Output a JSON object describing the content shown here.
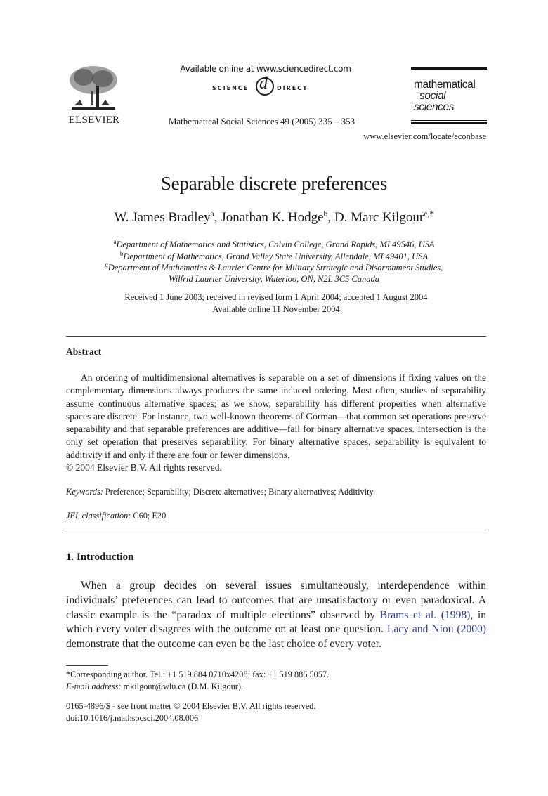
{
  "header": {
    "publisher_name": "ELSEVIER",
    "sciencedirect_available": "Available online at www.sciencedirect.com",
    "sciencedirect_logo_left": "SCIENCE",
    "sciencedirect_logo_at": "d",
    "sciencedirect_logo_right": "DIRECT",
    "journal_reference": "Mathematical Social Sciences 49 (2005) 335 – 353",
    "journal_logo": {
      "line1": "mathematical",
      "line2": "social",
      "line3": "sciences"
    },
    "journal_url": "www.elsevier.com/locate/econbase",
    "icons": {
      "publisher_logo": "elsevier-tree-logo",
      "sd_logo": "sciencedirect-logo"
    }
  },
  "article": {
    "title": "Separable discrete preferences",
    "authors": [
      {
        "name": "W. James Bradley",
        "affil": "a",
        "sep": ", "
      },
      {
        "name": "Jonathan K. Hodge",
        "affil": "b",
        "sep": ", "
      },
      {
        "name": "D. Marc Kilgour",
        "affil": "c,*",
        "sep": ""
      }
    ],
    "affiliations": [
      {
        "mark": "a",
        "text": "Department of Mathematics and Statistics, Calvin College, Grand Rapids, MI 49546, USA"
      },
      {
        "mark": "b",
        "text": "Department of Mathematics, Grand Valley State University, Allendale, MI 49401, USA"
      },
      {
        "mark": "c",
        "text": "Department of Mathematics & Laurier Centre for Military Strategic and Disarmament Studies,"
      },
      {
        "mark": "",
        "text": "Wilfrid Laurier University, Waterloo, ON, N2L 3C5 Canada"
      }
    ],
    "dates": {
      "received": "Received 1 June 2003; received in revised form 1 April 2004; accepted 1 August 2004",
      "online": "Available online 11 November 2004"
    }
  },
  "abstract": {
    "heading": "Abstract",
    "text": "An ordering of multidimensional alternatives is separable on a set of dimensions if fixing values on the complementary dimensions always produces the same induced ordering. Most often, studies of separability assume continuous alternative spaces; as we show, separability has different properties when alternative spaces are discrete. For instance, two well-known theorems of Gorman—that common set operations preserve separability and that separable preferences are additive—fail for binary alternative spaces. Intersection is the only set operation that preserves separability. For binary alternative spaces, separability is equivalent to additivity if and only if there are four or fewer dimensions.",
    "copyright": "© 2004 Elsevier B.V. All rights reserved."
  },
  "keywords": {
    "label": "Keywords:",
    "value": "Preference; Separability; Discrete alternatives; Binary alternatives; Additivity"
  },
  "jel": {
    "label": "JEL classification:",
    "value": "C60; E20"
  },
  "introduction": {
    "heading": "1. Introduction",
    "parts": {
      "p1": "When a group decides on several issues simultaneously, interdependence within individuals’ preferences can lead to outcomes that are unsatisfactory or even paradoxical. A classic example is the “paradox of multiple elections” observed by ",
      "cite1": "Brams et al. (1998)",
      "p2": ", in which every voter disagrees with the outcome on at least one question. ",
      "cite2": "Lacy and Niou (2000)",
      "p3": " demonstrate that the outcome can even be the last choice of every voter."
    },
    "link_color": "#2b3a8f"
  },
  "footnotes": {
    "corresponding": "*Corresponding author. Tel.: +1 519 884 0710x4208; fax: +1 519 886 5057.",
    "email_label": "E-mail address:",
    "email_value": " mkilgour@wlu.ca (D.M. Kilgour).",
    "issn": "0165-4896/$ - see front matter © 2004 Elsevier B.V. All rights reserved.",
    "doi": "doi:10.1016/j.mathsocsci.2004.08.006"
  }
}
